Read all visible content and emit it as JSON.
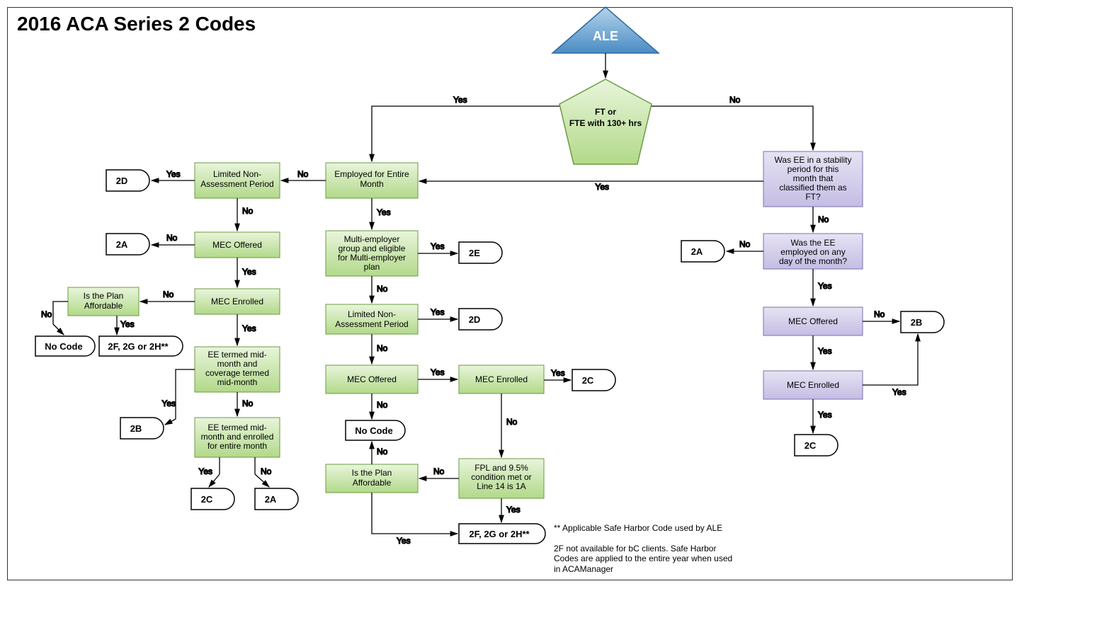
{
  "title": "2016 ACA Series 2 Codes",
  "shapes": {
    "ale": "ALE",
    "ft": "FT or\nFTE with 130+ hrs",
    "employed_entire_month": "Employed for Entire\nMonth",
    "limited_non_assessment_left": "Limited Non-\nAssessment Period",
    "mec_offered_left": "MEC Offered",
    "mec_enrolled_left": "MEC Enrolled",
    "plan_affordable_left": "Is the Plan\nAffordable",
    "ee_termed_coverage_mid": "EE termed mid-\nmonth and\ncoverage termed\nmid-month",
    "ee_termed_enrolled_entire": "EE termed mid-\nmonth and enrolled\nfor entire month",
    "multi_employer": "Multi-employer\ngroup and eligible\nfor Multi-employer\nplan",
    "limited_non_assessment_center": "Limited Non-\nAssessment Period",
    "mec_offered_center": "MEC Offered",
    "mec_enrolled_center": "MEC Enrolled",
    "fpl_condition": "FPL and 9.5%\ncondition met or\nLine 14 is 1A",
    "plan_affordable_center": "Is the Plan\nAffordable",
    "stability_period": "Was EE in a stability\nperiod for this\nmonth that\nclassified them as\nFT?",
    "ee_employed_any_day": "Was the EE\nemployed on any\nday of the month?",
    "mec_offered_right": "MEC Offered",
    "mec_enrolled_right": "MEC Enrolled"
  },
  "terminals": {
    "t2D_left": "2D",
    "t2A_left": "2A",
    "no_code_left": "No Code",
    "t2F2G2H_left": "2F, 2G or 2H**",
    "t2B_left": "2B",
    "t2C_left": "2C",
    "t2A_left2": "2A",
    "t2E": "2E",
    "t2D_center": "2D",
    "t2C_center": "2C",
    "no_code_center": "No Code",
    "t2F2G2H_center": "2F, 2G or 2H**",
    "t2A_right": "2A",
    "t2B_right": "2B",
    "t2C_right": "2C"
  },
  "labels": {
    "yes": "Yes",
    "no": "No"
  },
  "footnotes": {
    "line1": "** Applicable Safe Harbor Code used by ALE",
    "line2": "2F not available for bC clients. Safe Harbor Codes are applied to the entire year when used in ACAManager"
  }
}
